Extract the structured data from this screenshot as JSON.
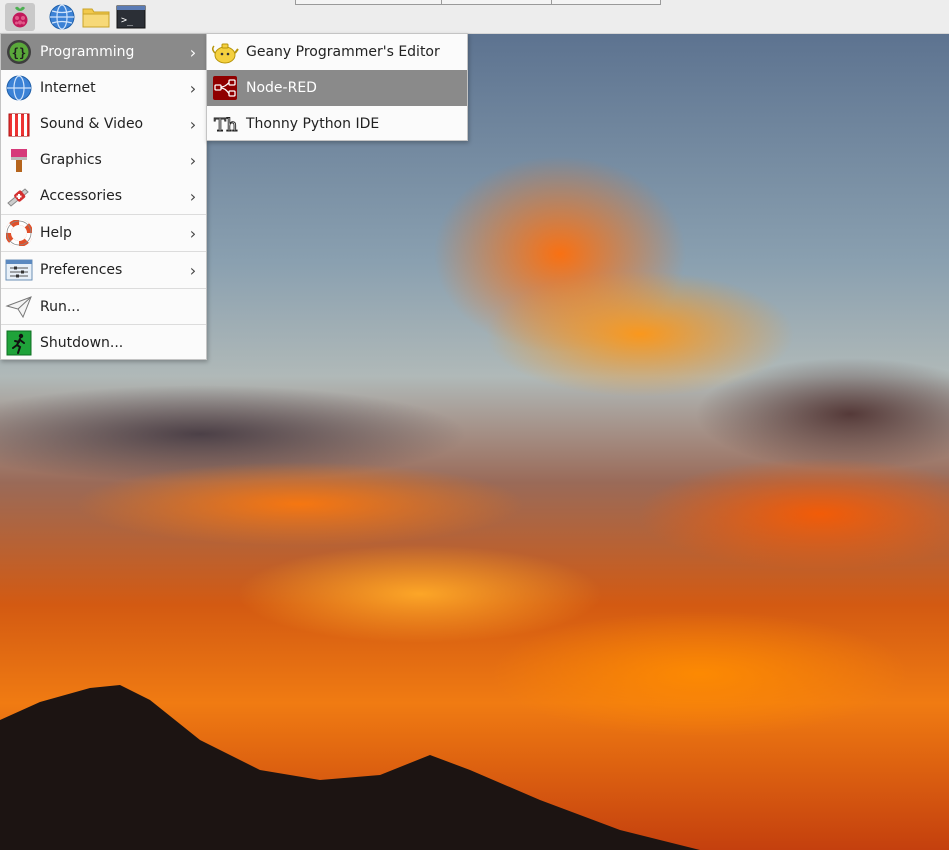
{
  "panel": {
    "launchers": [
      {
        "name": "raspberry-menu-icon",
        "active": true
      },
      {
        "name": "web-browser-icon"
      },
      {
        "name": "file-manager-icon"
      },
      {
        "name": "terminal-icon",
        "glyph": ">_"
      }
    ]
  },
  "main_menu": {
    "items": [
      {
        "label": "Programming",
        "icon": "braces-icon",
        "has_submenu": true,
        "highlighted": true
      },
      {
        "label": "Internet",
        "icon": "globe-icon",
        "has_submenu": true
      },
      {
        "label": "Sound & Video",
        "icon": "popcorn-icon",
        "has_submenu": true
      },
      {
        "label": "Graphics",
        "icon": "paintbrush-icon",
        "has_submenu": true
      },
      {
        "label": "Accessories",
        "icon": "swiss-knife-icon",
        "has_submenu": true
      },
      {
        "label": "Help",
        "icon": "lifebuoy-icon",
        "has_submenu": true
      },
      {
        "label": "Preferences",
        "icon": "settings-panel-icon",
        "has_submenu": true
      },
      {
        "label": "Run...",
        "icon": "paper-plane-icon",
        "has_submenu": false
      },
      {
        "label": "Shutdown...",
        "icon": "running-man-icon",
        "has_submenu": false
      }
    ],
    "submenu_arrow": "›"
  },
  "programming_submenu": {
    "items": [
      {
        "label": "Geany Programmer's Editor",
        "icon": "geany-teapot-icon"
      },
      {
        "label": "Node-RED",
        "icon": "node-red-icon",
        "highlighted": true
      },
      {
        "label": "Thonny Python IDE",
        "icon": "thonny-icon",
        "glyph": "Th"
      }
    ]
  }
}
